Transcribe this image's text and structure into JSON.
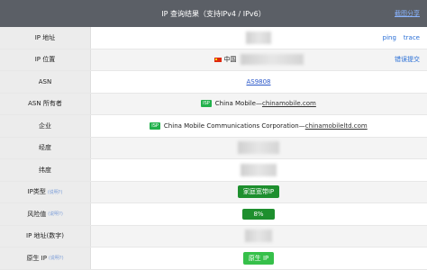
{
  "header": {
    "title": "IP 查询结果（支持IPv4 / IPv6）",
    "link": "截图分享"
  },
  "rows": [
    {
      "label": "IP 地址",
      "links": [
        "ping",
        "trace"
      ]
    },
    {
      "label": "IP 位置",
      "country": "中国",
      "action": "错误提交"
    },
    {
      "label": "ASN",
      "value": "AS9808"
    },
    {
      "label": "ASN 所有者",
      "tag": "ISP",
      "text": "China Mobile—",
      "link": "chinamobile.com"
    },
    {
      "label": "企业",
      "tag": "ISP",
      "text": "China Mobile Communications Corporation—",
      "link": "chinamobileltd.com"
    },
    {
      "label": "经度"
    },
    {
      "label": "纬度"
    },
    {
      "label": "IP类型",
      "help": "(说明?)",
      "badge": "家庭宽带IP"
    },
    {
      "label": "风险值",
      "help": "(说明?)",
      "badge": "8%"
    },
    {
      "label": "IP 地址(数字)"
    },
    {
      "label": "原生 IP",
      "help": "(说明?)",
      "badge": "原生 IP"
    }
  ]
}
